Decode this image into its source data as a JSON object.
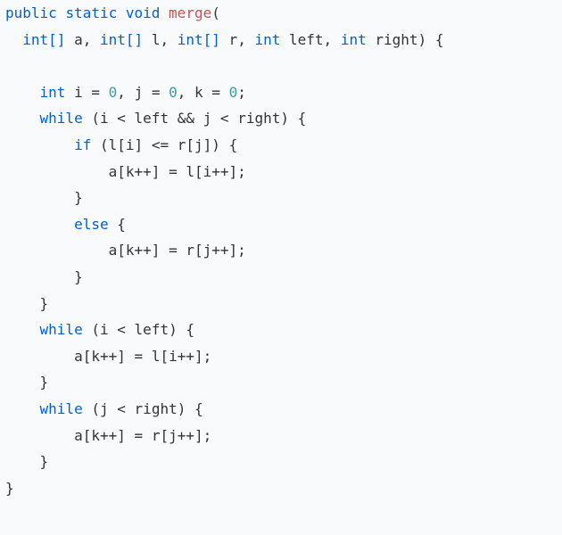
{
  "code": {
    "keywords": {
      "public": "public",
      "static": "static",
      "void": "void",
      "int": "int",
      "intArr": "int[]",
      "while": "while",
      "if": "if",
      "else": "else"
    },
    "fn": "merge",
    "params": {
      "a": "a",
      "l": "l",
      "r": "r",
      "left": "left",
      "right": "right"
    },
    "vars": {
      "i": "i",
      "j": "j",
      "k": "k"
    },
    "nums": {
      "zero": "0"
    },
    "punct": {
      "lparen": "(",
      "rparen": ")",
      "lbrace": "{",
      "rbrace": "}",
      "lbrack": "[",
      "rbrack": "]",
      "comma": ",",
      "semi": ";",
      "eq": "=",
      "lt": "<",
      "lteq": "<=",
      "and": "&&",
      "pp": "++"
    }
  }
}
